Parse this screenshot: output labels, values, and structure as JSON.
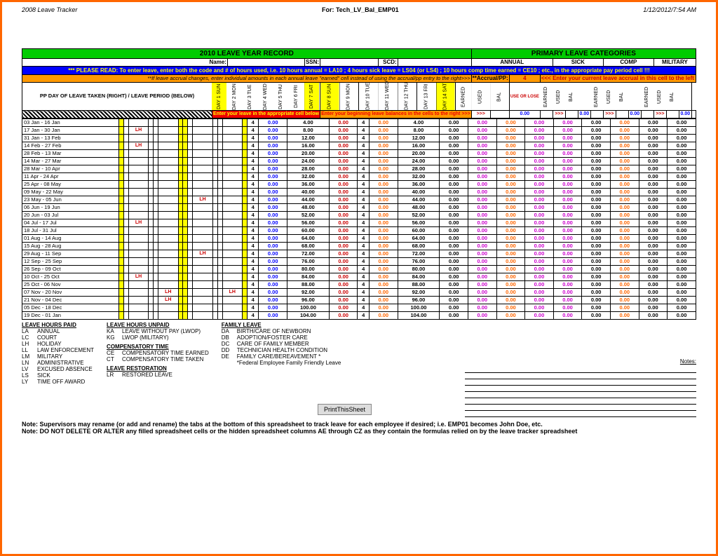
{
  "header": {
    "left": "2008 Leave Tracker",
    "center": "For: Tech_LV_Bal_EMP01",
    "right": "1/12/2012/7:54 AM"
  },
  "titles": {
    "left": "2010 LEAVE YEAR RECORD",
    "right": "PRIMARY LEAVE CATEGORIES"
  },
  "labels": {
    "name": "Name:",
    "ssn": "SSN:",
    "scd": "SCD:",
    "annual": "ANNUAL",
    "sick": "SICK",
    "comp": "COMP",
    "military": "MILITARY",
    "accrualPP": "**Accrual/PP:",
    "ppHeader": "PP DAY OF LEAVE TAKEN (RIGHT) / LEAVE  PERIOD (BELOW)",
    "notes": "Notes:",
    "printBtn": "PrintThisSheet"
  },
  "values": {
    "accrualPP": "4"
  },
  "messages": {
    "pleaseRead": "*** PLEASE READ: To enter leave, enter both the code and # of hours used, i.e. 10 hours annual = LA10 ; 4 hours sick leave = LS04 (or LS4) ; 10 hours comp time earned = CE10 ; etc., in the appropriate pay period cell !!!",
    "accrual": "**If leave accrual changes, enter individual amounts in each  annual leave \"earned\"  cell instead of using the accrual/pp entry to the right>>>",
    "accrualHint": "<<< Enter your current leave accrual in this cell to the left",
    "enterLeave": "Enter your leave in the appropriate cell below",
    "enterBalances": "Enter your beginning leave balances in the cells to the right >>>",
    "note1": "Note:  Supervisors may rename (or add and rename) the tabs at the bottom of this spreadsheet to track leave for each employee if desired;  i.e. EMP01 becomes John Doe, etc.",
    "note2": "Note:  DO NOT DELETE OR ALTER any filled spreadsheet cells or the hidden spreadsheet columns AE through CZ as they contain the formulas relied on by the leave tracker spreadsheet"
  },
  "days": [
    "DAY 1  SUN",
    "DAY 2  MON",
    "DAY 3  TUE",
    "DAY 4  WED",
    "DAY 5  THU",
    "DAY 6  FRI",
    "DAY 7  SAT",
    "DAY 8  SUN",
    "DAY 9  MON",
    "DAY 10  TUE",
    "DAY 11  WED",
    "DAY 12  THU",
    "DAY 13  FRI",
    "DAY 14  SAT",
    "",
    ""
  ],
  "catCols": [
    "EARNED",
    "USED",
    "BAL",
    "USE OR LOSE",
    "EARNED",
    "USED",
    "BAL",
    "",
    "EARNED",
    "USED",
    "BAL",
    "",
    "EARNED",
    "USED",
    "BAL",
    ""
  ],
  "subVals": [
    ">>>",
    "",
    "0.00",
    "",
    ">>>",
    "",
    "0.00",
    "",
    ">>>",
    "",
    "0.00",
    "",
    ">>>",
    "",
    "0.00",
    ""
  ],
  "periods": [
    {
      "p": "03 Jan - 16 Jan",
      "lh": [],
      "bal": "4.00"
    },
    {
      "p": "17 Jan - 30 Jan",
      "lh": [
        2
      ],
      "bal": "8.00"
    },
    {
      "p": "31 Jan - 13 Feb",
      "lh": [],
      "bal": "12.00"
    },
    {
      "p": "14 Feb - 27 Feb",
      "lh": [
        2
      ],
      "bal": "16.00"
    },
    {
      "p": "28 Feb - 13 Mar",
      "lh": [],
      "bal": "20.00"
    },
    {
      "p": "14 Mar - 27 Mar",
      "lh": [],
      "bal": "24.00"
    },
    {
      "p": "28 Mar - 10 Apr",
      "lh": [],
      "bal": "28.00"
    },
    {
      "p": "11 Apr - 24 Apr",
      "lh": [],
      "bal": "32.00"
    },
    {
      "p": "25 Apr - 08 May",
      "lh": [],
      "bal": "36.00"
    },
    {
      "p": "09 May - 22 May",
      "lh": [],
      "bal": "40.00"
    },
    {
      "p": "23 May - 05 Jun",
      "lh": [
        9
      ],
      "bal": "44.00"
    },
    {
      "p": "06 Jun - 19 Jun",
      "lh": [],
      "bal": "48.00"
    },
    {
      "p": "20 Jun - 03 Jul",
      "lh": [],
      "bal": "52.00"
    },
    {
      "p": "04 Jul - 17 Jul",
      "lh": [
        2
      ],
      "bal": "56.00"
    },
    {
      "p": "18 Jul - 31 Jul",
      "lh": [],
      "bal": "60.00"
    },
    {
      "p": "01 Aug - 14 Aug",
      "lh": [],
      "bal": "64.00"
    },
    {
      "p": "15 Aug - 28 Aug",
      "lh": [],
      "bal": "68.00"
    },
    {
      "p": "29 Aug - 11 Sep",
      "lh": [
        9
      ],
      "bal": "72.00"
    },
    {
      "p": "12 Sep - 25 Sep",
      "lh": [],
      "bal": "76.00"
    },
    {
      "p": "26 Sep - 09 Oct",
      "lh": [],
      "bal": "80.00"
    },
    {
      "p": "10 Oct - 25 Oct",
      "lh": [
        2
      ],
      "bal": "84.00"
    },
    {
      "p": "25 Oct - 06 Nov",
      "lh": [],
      "bal": "88.00"
    },
    {
      "p": "07 Nov - 20 Nov",
      "lh": [
        5,
        12
      ],
      "bal": "92.00"
    },
    {
      "p": "21 Nov - 04 Dec",
      "lh": [
        5
      ],
      "bal": "96.00"
    },
    {
      "p": "05 Dec - 18 Dec",
      "lh": [],
      "bal": "100.00"
    },
    {
      "p": "19 Dec - 01 Jan",
      "lh": [],
      "bal": "104.00"
    }
  ],
  "legend": {
    "paid": {
      "title": "LEAVE HOURS PAID",
      "items": [
        [
          "LA",
          "ANNUAL"
        ],
        [
          "LC",
          "COURT"
        ],
        [
          "LH",
          "HOLIDAY"
        ],
        [
          "LL",
          "LAW ENFORCEMENT"
        ],
        [
          "LM",
          "MILITARY"
        ],
        [
          "LN",
          "ADMINISTRATIVE"
        ],
        [
          "LV",
          "EXCUSED ABSENCE"
        ],
        [
          "LS",
          "SICK"
        ],
        [
          "LY",
          "TIME OFF AWARD"
        ]
      ]
    },
    "unpaid": {
      "title": "LEAVE HOURS UNPAID",
      "items": [
        [
          "KA",
          "LEAVE WITHOUT PAY (LWOP)"
        ],
        [
          "KG",
          "LWOP (MILITARY)"
        ]
      ]
    },
    "compTime": {
      "title": "COMPENSATORY TIME",
      "items": [
        [
          "CE",
          "COMPENSATORY TIME EARNED"
        ],
        [
          "CT",
          "COMPENSATORY TIME TAKEN"
        ]
      ]
    },
    "restoration": {
      "title": "LEAVE RESTORATION",
      "items": [
        [
          "LR",
          "RESTORED LEAVE"
        ]
      ]
    },
    "family": {
      "title": "FAMILY LEAVE",
      "items": [
        [
          "DA",
          "BIRTH/CARE OF NEWBORN"
        ],
        [
          "DB",
          "ADOPTION/FOSTER CARE"
        ],
        [
          "DC",
          "CARE OF FAMILY MEMBER"
        ],
        [
          "DD",
          "TECHNICIAN HEALTH CONDITION"
        ],
        [
          "DE",
          "FAMILY CARE/BEREAVEMENT *"
        ],
        [
          "",
          "*Federal Employee Family Friendly Leave"
        ]
      ]
    }
  }
}
